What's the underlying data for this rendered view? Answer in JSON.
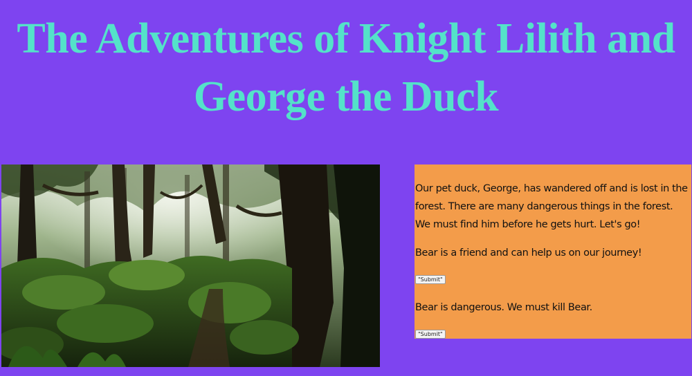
{
  "title": "The Adventures of Knight Lilith and George the Duck",
  "image": {
    "subject": "forest-photo"
  },
  "colors": {
    "background": "#7e44f0",
    "title": "#54e2c9",
    "panel": "#f39c4a"
  },
  "story": {
    "intro": "Our pet duck, George, has wandered off and is lost in the forest. There are many dangerous things in the forest. We must find him before he gets hurt. Let's go!",
    "choices": [
      {
        "text": "Bear is a friend and can help us on our journey!",
        "button": "\"Submit\""
      },
      {
        "text": "Bear is dangerous. We must kill Bear.",
        "button": "\"Submit\""
      }
    ]
  }
}
